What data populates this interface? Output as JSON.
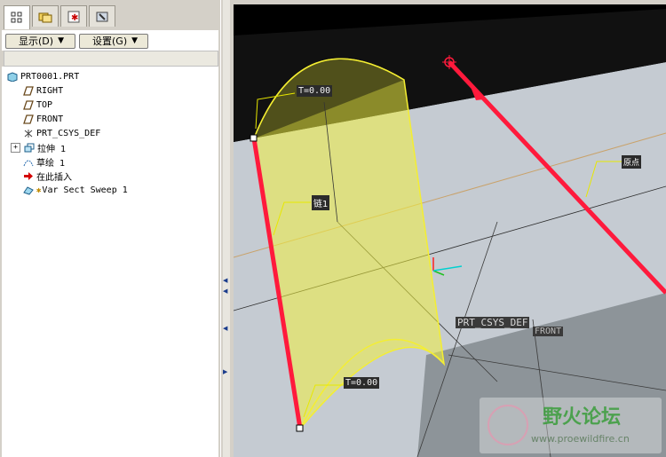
{
  "tabs": [
    {
      "icon": "model-tree-icon"
    },
    {
      "icon": "folder-browser-icon"
    },
    {
      "icon": "favorites-icon"
    },
    {
      "icon": "tools-icon"
    }
  ],
  "toolbar": {
    "show_label": "显示(D)",
    "settings_label": "设置(G)"
  },
  "tree": {
    "root": "PRT0001.PRT",
    "items": [
      {
        "label": "RIGHT",
        "icon": "datum-plane-icon"
      },
      {
        "label": "TOP",
        "icon": "datum-plane-icon"
      },
      {
        "label": "FRONT",
        "icon": "datum-plane-icon"
      },
      {
        "label": "PRT_CSYS_DEF",
        "icon": "csys-icon"
      },
      {
        "label": "拉伸 1",
        "icon": "extrude-icon"
      },
      {
        "label": "草绘 1",
        "icon": "sketch-icon"
      },
      {
        "label": "在此插入",
        "icon": "insert-here-arrow-icon"
      },
      {
        "label": "Var Sect Sweep 1",
        "icon": "var-sect-sweep-icon"
      }
    ]
  },
  "viewport": {
    "tag_t_top": "T=0.00",
    "tag_chain": "链1",
    "tag_origin": "原点",
    "tag_t_bottom": "T=0.00",
    "tag_csys": "PRT_CSYS_DEF",
    "tag_front": "FRONT",
    "watermark_brand": "野火论坛",
    "watermark_url": "www.proewildfire.cn",
    "colors": {
      "surface": "#f0f040",
      "trajectory": "#ff1a3c",
      "plate": "#c5cbd2",
      "tag_bg": "#2b2b2b"
    }
  }
}
